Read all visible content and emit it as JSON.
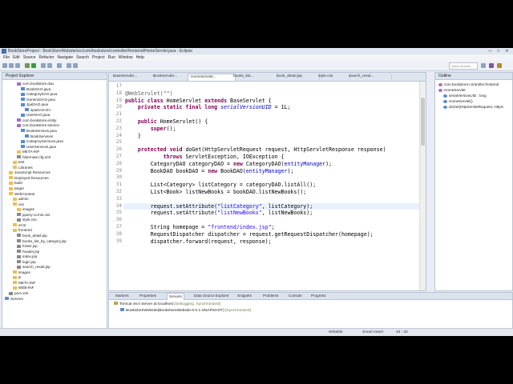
{
  "window": {
    "title": "BookStoreProject - BookStoreWebsite/src/com/bookstore/controller/frontend/HomeServlet.java - Eclipse",
    "min": "—",
    "max": "□",
    "close": "✕"
  },
  "menu": [
    "File",
    "Edit",
    "Source",
    "Refactor",
    "Navigate",
    "Search",
    "Project",
    "Run",
    "Window",
    "Help"
  ],
  "toolbar": {
    "quick_access": "Quick Access"
  },
  "explorer": {
    "title": "Project Explorer",
    "items": [
      {
        "label": "com.bookstore.dao",
        "icon": "pkg",
        "indent": 3
      },
      {
        "label": "BookDAO.java",
        "icon": "jfile",
        "indent": 4
      },
      {
        "label": "CategoryDAO.java",
        "icon": "jfile",
        "indent": 4
      },
      {
        "label": "GenericDAO.java",
        "icon": "jfile",
        "indent": 4
      },
      {
        "label": "JpaDAO.java",
        "icon": "jfile",
        "indent": 4
      },
      {
        "label": "JpaDAO<E>",
        "icon": "jfile",
        "indent": 5
      },
      {
        "label": "UserDAO.java",
        "icon": "jfile",
        "indent": 4
      },
      {
        "label": "com.bookstore.entity",
        "icon": "pkg",
        "indent": 3
      },
      {
        "label": "com.bookstore.service",
        "icon": "pkg",
        "indent": 3
      },
      {
        "label": "BookServices.java",
        "icon": "jfile",
        "indent": 4
      },
      {
        "label": "BookServices",
        "icon": "jfile",
        "indent": 5
      },
      {
        "label": "CategoryServices.java",
        "icon": "jfile",
        "indent": 4
      },
      {
        "label": "UserServices.java",
        "icon": "jfile",
        "indent": 4
      },
      {
        "label": "META-INF",
        "icon": "fld",
        "indent": 3
      },
      {
        "label": "hibernate.cfg.xml",
        "icon": "xfile",
        "indent": 3
      },
      {
        "label": "test",
        "icon": "fld",
        "indent": 2
      },
      {
        "label": "Libraries",
        "icon": "fld",
        "indent": 2
      },
      {
        "label": "JavaScript Resources",
        "icon": "fld",
        "indent": 1
      },
      {
        "label": "Deployed Resources",
        "icon": "fld",
        "indent": 1
      },
      {
        "label": "build",
        "icon": "fld",
        "indent": 1
      },
      {
        "label": "target",
        "icon": "fld",
        "indent": 1
      },
      {
        "label": "WebContent",
        "icon": "fld",
        "indent": 1
      },
      {
        "label": "admin",
        "icon": "fld",
        "indent": 2
      },
      {
        "label": "css",
        "icon": "fld",
        "indent": 2
      },
      {
        "label": "images",
        "icon": "fld",
        "indent": 3
      },
      {
        "label": "jquery-ui.min.css",
        "icon": "xfile",
        "indent": 3
      },
      {
        "label": "style.css",
        "icon": "xfile",
        "indent": 3
      },
      {
        "label": "error",
        "icon": "fld",
        "indent": 2
      },
      {
        "label": "frontend",
        "icon": "fld",
        "indent": 2
      },
      {
        "label": "book_detail.jsp",
        "icon": "xfile",
        "indent": 3
      },
      {
        "label": "books_list_by_category.jsp",
        "icon": "xfile",
        "indent": 3
      },
      {
        "label": "footer.jsp",
        "icon": "xfile",
        "indent": 3
      },
      {
        "label": "header.jsp",
        "icon": "xfile",
        "indent": 3
      },
      {
        "label": "index.jsp",
        "icon": "xfile",
        "indent": 3
      },
      {
        "label": "login.jsp",
        "icon": "xfile",
        "indent": 3
      },
      {
        "label": "search_result.jsp",
        "icon": "xfile",
        "indent": 3
      },
      {
        "label": "images",
        "icon": "fld",
        "indent": 2
      },
      {
        "label": "js",
        "icon": "fld",
        "indent": 2
      },
      {
        "label": "META-INF",
        "icon": "fld",
        "indent": 2
      },
      {
        "label": "WEB-INF",
        "icon": "fld",
        "indent": 2
      },
      {
        "label": "pom.xml",
        "icon": "xfile",
        "indent": 1
      },
      {
        "label": "Servers",
        "icon": "prj",
        "indent": 0
      }
    ]
  },
  "editor": {
    "tabs": [
      "BaseServlet...",
      "BookServlet...",
      "HomeServlet...",
      "books_list...",
      "book_detail.jsp",
      "style.css",
      "search_resul..."
    ],
    "active_tab": 2,
    "lines": [
      {
        "n": "17",
        "html": ""
      },
      {
        "n": "18",
        "html": "<span class=\"a\">@WebServlet(\"\")</span>"
      },
      {
        "n": "19",
        "html": "<span class=\"k\">public class</span> HomeServlet <span class=\"k\">extends</span> BaseServlet {"
      },
      {
        "n": "20",
        "html": "    <span class=\"k\">private static final long</span> <span class=\"c\">serialVersionUID</span> = 1L;"
      },
      {
        "n": "21",
        "html": ""
      },
      {
        "n": "22",
        "html": "    <span class=\"k\">public</span> HomeServlet() {"
      },
      {
        "n": "23",
        "html": "        <span class=\"k\">super</span>();"
      },
      {
        "n": "24",
        "html": "    }"
      },
      {
        "n": "25",
        "html": ""
      },
      {
        "n": "26",
        "html": "    <span class=\"k\">protected void</span> doGet(HttpServletRequest request, HttpServletResponse response)"
      },
      {
        "n": "27",
        "html": "            <span class=\"k\">throws</span> ServletException, IOException {"
      },
      {
        "n": "28",
        "html": "        CategoryDAO categoryDAO = <span class=\"k\">new</span> CategoryDAO(<span class=\"f\">entityManager</span>);"
      },
      {
        "n": "29",
        "html": "        BookDAO bookDAO = <span class=\"k\">new</span> BookDAO(<span class=\"f\">entityManager</span>);"
      },
      {
        "n": "30",
        "html": ""
      },
      {
        "n": "31",
        "html": "        List&lt;Category&gt; listCategory = categoryDAO.listAll();"
      },
      {
        "n": "32",
        "html": "        List&lt;Book&gt; listNewBooks = bookDAO.listNewBooks();"
      },
      {
        "n": "33",
        "html": ""
      },
      {
        "n": "34",
        "html": "        request.setAttribute(<span class=\"s\">\"listCategory\"</span>, listCategory);"
      },
      {
        "n": "35",
        "html": "        request.setAttribute(<span class=\"s\">\"listNewBooks\"</span>, listNewBooks);"
      },
      {
        "n": "36",
        "html": ""
      },
      {
        "n": "37",
        "html": "        String homepage = <span class=\"s\">\"frontend/index.jsp\"</span>;"
      },
      {
        "n": "38",
        "html": "        RequestDispatcher dispatcher = request.getRequestDispatcher(homepage);"
      },
      {
        "n": "39",
        "html": "        dispatcher.forward(request, response);"
      }
    ]
  },
  "outline": {
    "title": "Outline",
    "items": [
      {
        "label": "com.bookstore.controller.frontend",
        "indent": 0
      },
      {
        "label": "HomeServlet",
        "indent": 0
      },
      {
        "label": "serialVersionUID : long",
        "indent": 1
      },
      {
        "label": "HomeServlet()",
        "indent": 1
      },
      {
        "label": "doGet(HttpServletRequest, HttpS",
        "indent": 1
      }
    ]
  },
  "servers": {
    "tabs": [
      "Markers",
      "Properties",
      "Servers",
      "Data Source Explorer",
      "Snippets",
      "Problems",
      "Console",
      "Progress"
    ],
    "active_tab": 2,
    "server": "Tomcat v8.0 Server at localhost",
    "server_state": "[Debugging, Synchronized]",
    "module": "BookStoreWebsite(BookStoreWebsite-0.0.1-SNAPSHOT)",
    "module_state": "[Synchronized]"
  },
  "status": {
    "writable": "Writable",
    "insert": "Smart Insert",
    "position": "34 : 33"
  }
}
